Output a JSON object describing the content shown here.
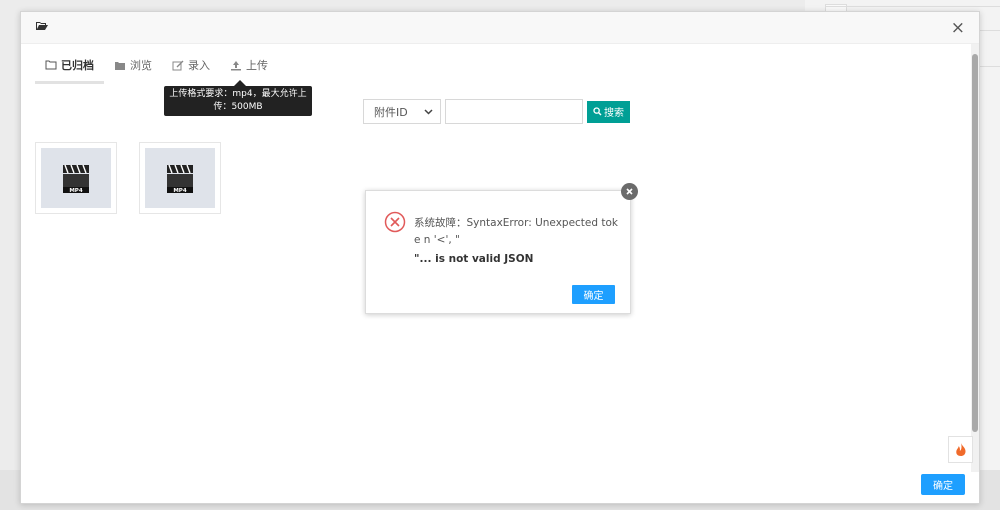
{
  "modal": {
    "close_symbol": "×",
    "confirm_label": "确定"
  },
  "tabs": [
    {
      "label": "已归档",
      "icon": "archive-icon",
      "active": true
    },
    {
      "label": "浏览",
      "icon": "folder-icon",
      "active": false
    },
    {
      "label": "录入",
      "icon": "edit-icon",
      "active": false
    },
    {
      "label": "上传",
      "icon": "upload-icon",
      "active": false
    }
  ],
  "tooltip": {
    "line1": "上传格式要求：mp4，最大允许上",
    "line2": "传：500MB"
  },
  "search": {
    "field_selected": "附件ID",
    "input_value": "",
    "button_label": "搜索"
  },
  "files": [
    {
      "type": "MP4"
    },
    {
      "type": "MP4"
    }
  ],
  "error_dialog": {
    "message_line1": "系统故障：SyntaxError: Unexpected toke n '<', \"",
    "message_line2": "\"... is not valid JSON",
    "ok_label": "确定"
  },
  "colors": {
    "primary_blue": "#1e9fff",
    "search_green": "#009f95",
    "error_red": "#e15a5a"
  }
}
